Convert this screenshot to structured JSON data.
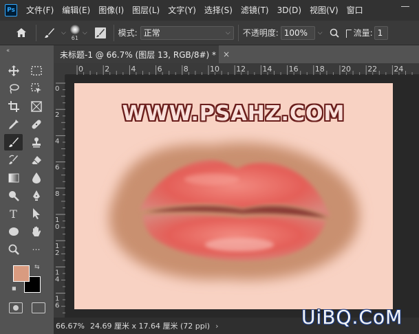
{
  "app": {
    "logo_text": "Ps",
    "menu": [
      "文件(F)",
      "编辑(E)",
      "图像(I)",
      "图层(L)",
      "文字(Y)",
      "选择(S)",
      "滤镜(T)",
      "3D(D)",
      "视图(V)",
      "窗口"
    ]
  },
  "options": {
    "brush_size": "61",
    "mode_label": "模式:",
    "mode_value": "正常",
    "opacity_label": "不透明度:",
    "opacity_value": "100%",
    "flow_label": "流量:",
    "flow_value": "1"
  },
  "document": {
    "tab_title": "未标题-1 @ 66.7% (图层 13, RGB/8#) *",
    "close_glyph": "×"
  },
  "rulers": {
    "top_ticks": [
      "0",
      "2",
      "4",
      "6",
      "8",
      "10",
      "12",
      "14",
      "16",
      "18",
      "20",
      "22",
      "24"
    ],
    "left_ticks": [
      "0",
      "2",
      "4",
      "6",
      "8",
      "1\n0",
      "1\n2",
      "1\n4",
      "1\n6"
    ]
  },
  "canvas": {
    "banner_text": "WWW.PSAHZ.COM",
    "background_color": "#f8d2c3",
    "foundation_color": "#c9906f",
    "lip_color": "#e85c55"
  },
  "swatches": {
    "foreground": "#d99b80",
    "background": "#000000"
  },
  "status": {
    "zoom": "66.67%",
    "doc_size": "24.69 厘米 x 17.64 厘米 (72 ppi)",
    "chevron": "›"
  },
  "watermark": "UiBQ.CoM"
}
